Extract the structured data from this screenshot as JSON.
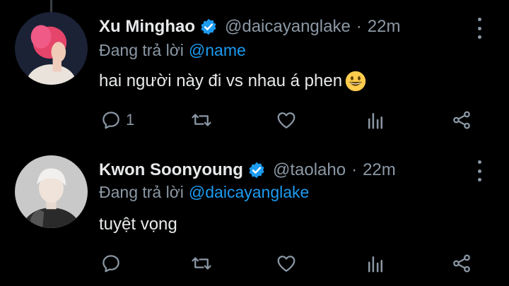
{
  "tweets": [
    {
      "display_name": "Xu Minghao",
      "handle": "@daicayanglake",
      "time": "22m",
      "reply_label": "Đang trả lời",
      "reply_to": "@name",
      "text": "hai người này đi vs nhau á phen",
      "emoji": "grinning-face-emoji",
      "reply_count": "1",
      "avatar_color": "#e5456a"
    },
    {
      "display_name": "Kwon Soonyoung",
      "handle": "@taolaho",
      "time": "22m",
      "reply_label": "Đang trả lời",
      "reply_to": "@daicayanglake",
      "text": "tuyệt vọng",
      "reply_count": "",
      "avatar_color": "#d8d8d8"
    }
  ],
  "separator": "·",
  "icons": [
    "reply-icon",
    "retweet-icon",
    "like-icon",
    "analytics-icon",
    "share-icon",
    "more-icon",
    "verified-badge-icon"
  ],
  "colors": {
    "background": "#000000",
    "accent": "#1d9bf0",
    "muted": "#8b98a5",
    "text": "#e7e9ea"
  }
}
